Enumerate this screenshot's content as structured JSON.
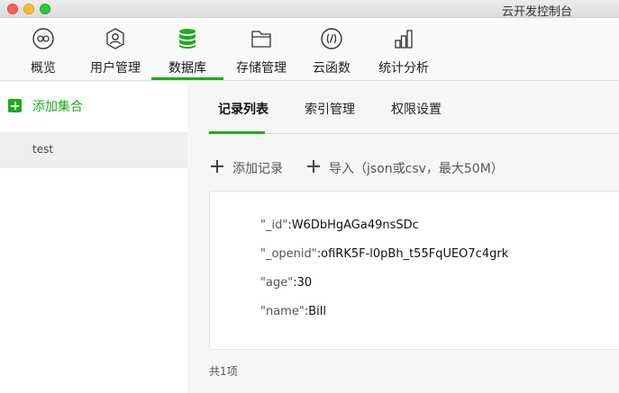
{
  "window": {
    "title": "云开发控制台"
  },
  "nav": {
    "items": [
      {
        "label": "概览",
        "icon": "infinity-icon"
      },
      {
        "label": "用户管理",
        "icon": "user-icon"
      },
      {
        "label": "数据库",
        "icon": "database-icon"
      },
      {
        "label": "存储管理",
        "icon": "folder-icon"
      },
      {
        "label": "云函数",
        "icon": "function-icon"
      },
      {
        "label": "统计分析",
        "icon": "bar-chart-icon"
      }
    ],
    "active": "数据库"
  },
  "sidebar": {
    "add_label": "添加集合",
    "collections": [
      {
        "name": "test"
      }
    ]
  },
  "main": {
    "tabs": [
      {
        "label": "记录列表"
      },
      {
        "label": "索引管理"
      },
      {
        "label": "权限设置"
      }
    ],
    "active_tab": "记录列表",
    "actions": {
      "add_record": "添加记录",
      "import": "导入（json或csv，最大50M）"
    },
    "record": [
      {
        "key": "\"_id\"",
        "value": ":W6DbHgAGa49nsSDc"
      },
      {
        "key": "\"_openid\"",
        "value": ":ofiRK5F-l0pBh_t55FqUEO7c4grk"
      },
      {
        "key": "\"age\"",
        "value": ":30"
      },
      {
        "key": "\"name\"",
        "value": ":Bill"
      }
    ],
    "footer_count": "共1项"
  },
  "colors": {
    "accent": "#1aad19"
  }
}
